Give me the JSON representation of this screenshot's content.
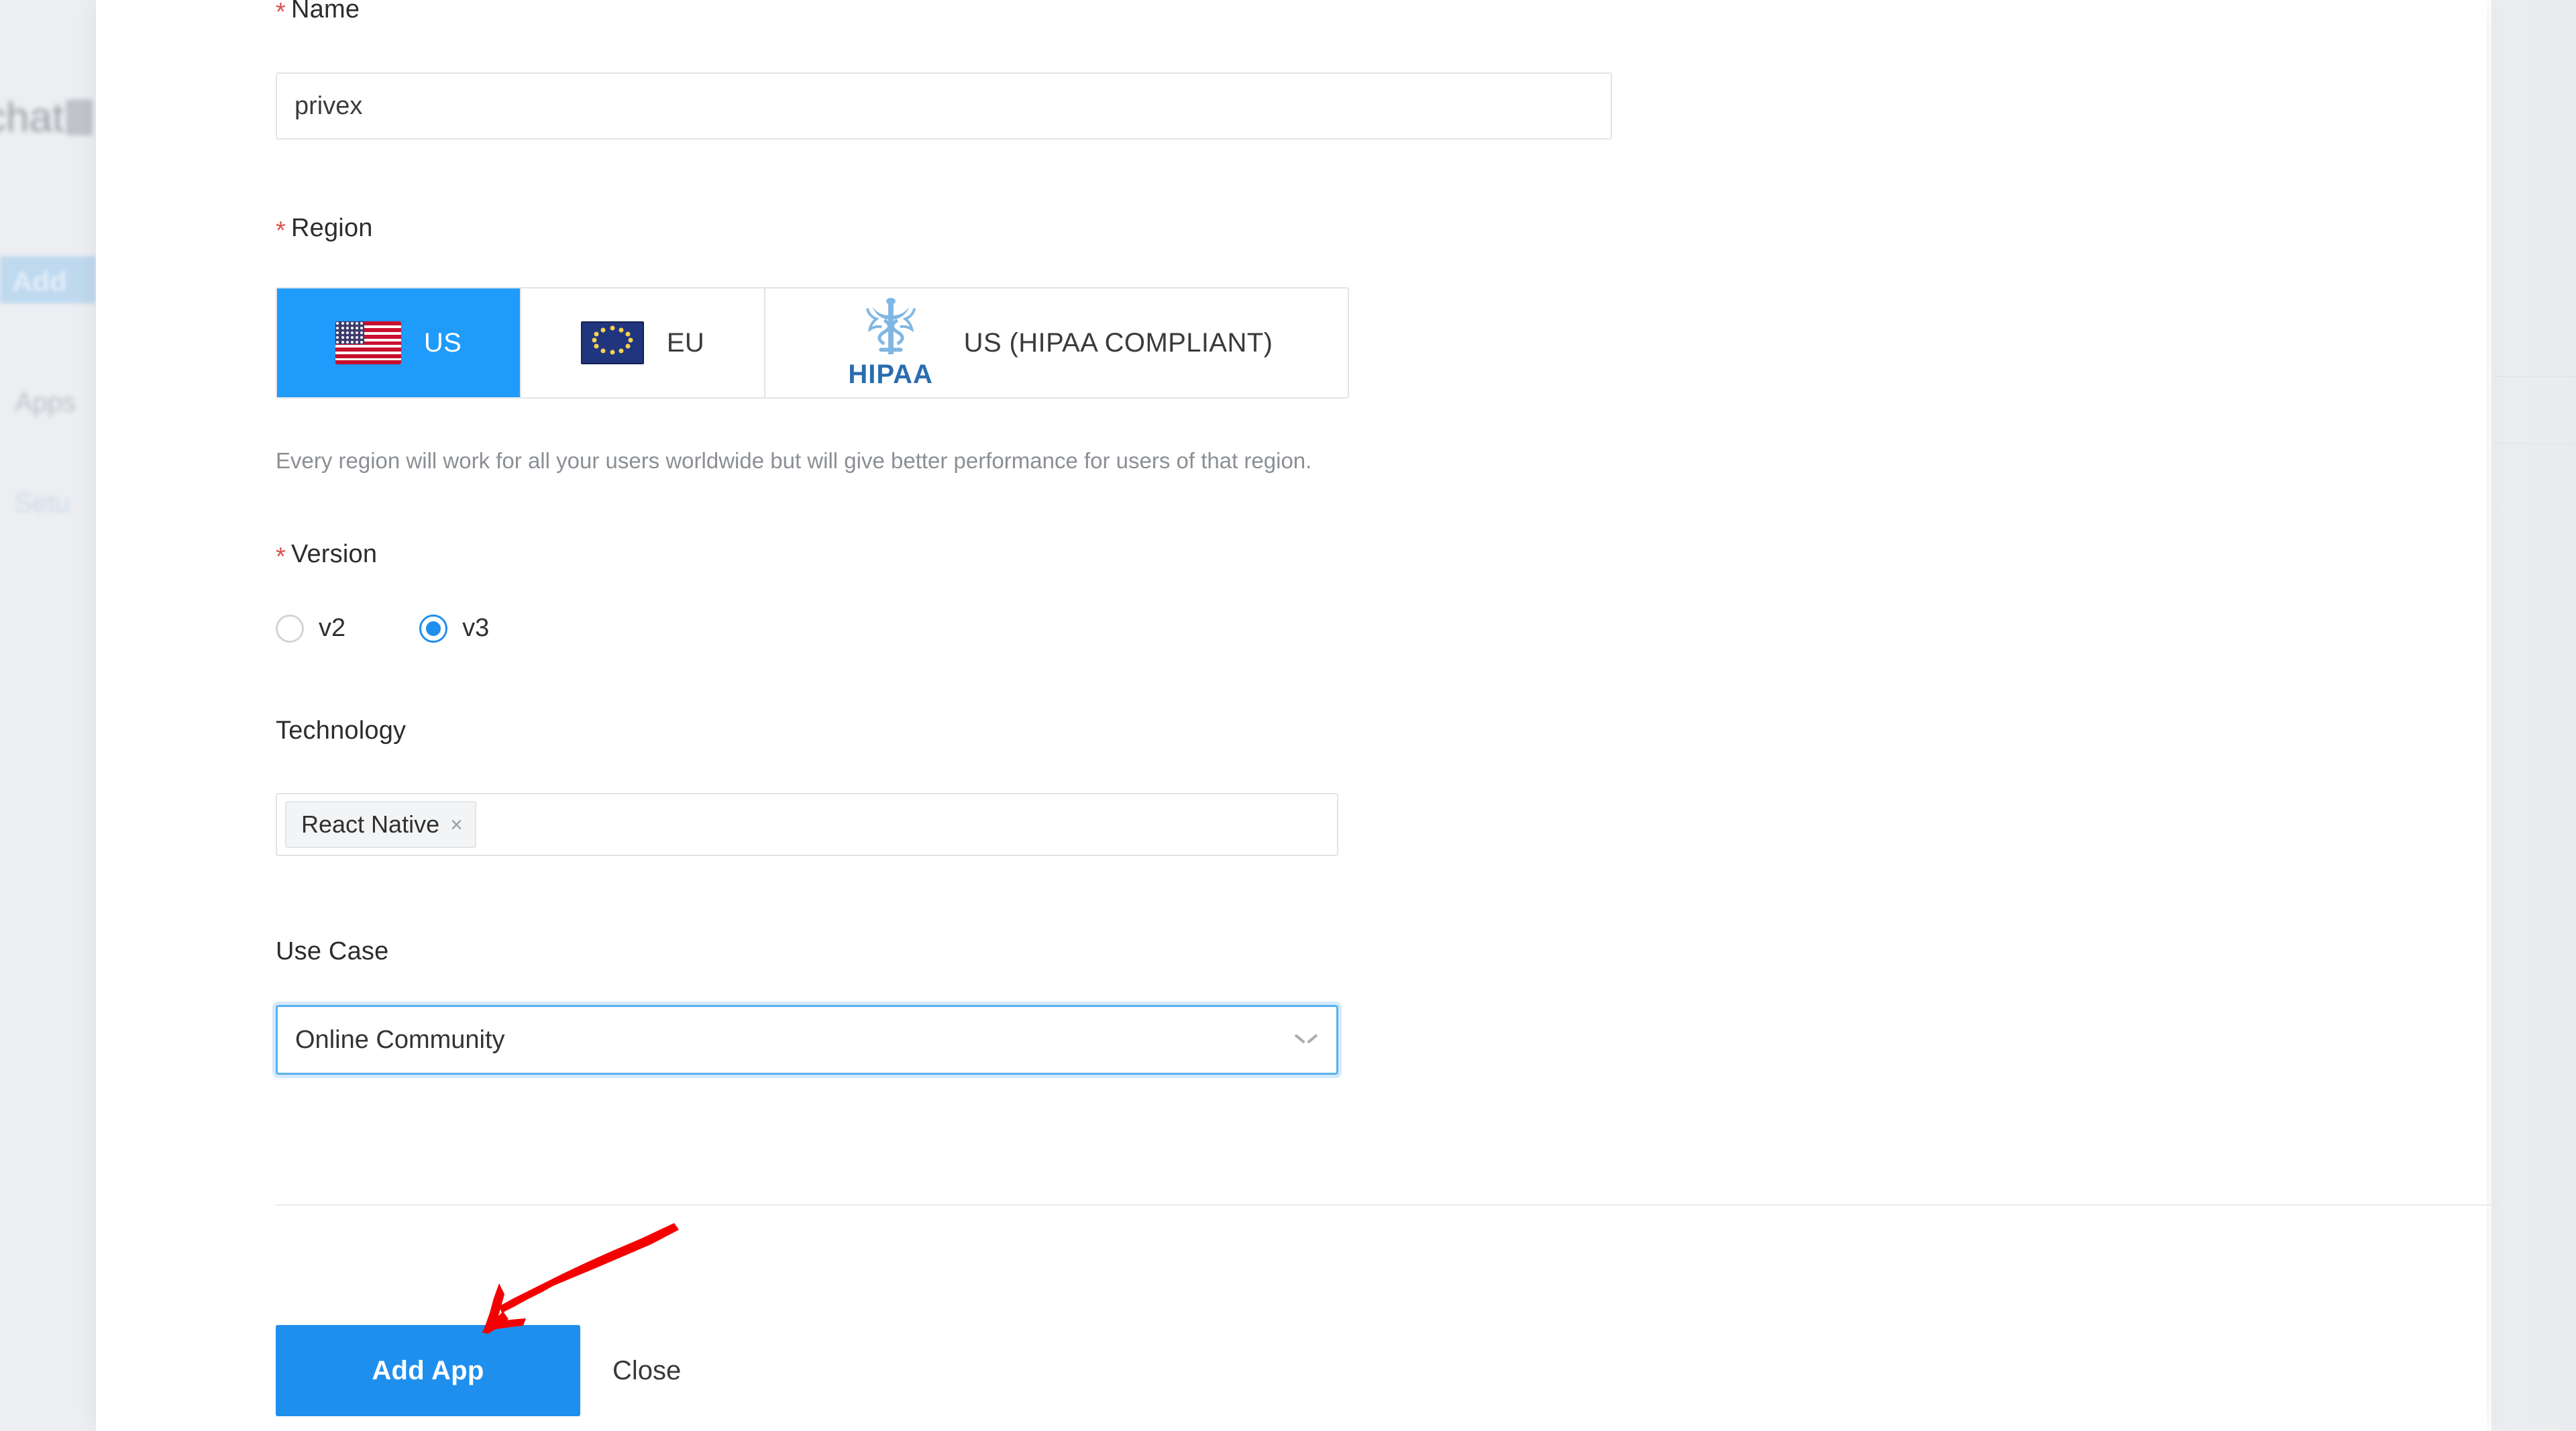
{
  "background": {
    "app_title": "chat",
    "nav_items": [
      "Add",
      "Apps",
      "Setu"
    ]
  },
  "modal": {
    "fields": {
      "name": {
        "label": "Name",
        "required_marker": "*",
        "value": "privex",
        "placeholder": ""
      },
      "region": {
        "label": "Region",
        "required_marker": "*",
        "options": [
          {
            "id": "us",
            "label": "US",
            "icon": "us-flag-icon",
            "selected": true
          },
          {
            "id": "eu",
            "label": "EU",
            "icon": "eu-flag-icon",
            "selected": false
          },
          {
            "id": "hipaa",
            "label": "US (HIPAA COMPLIANT)",
            "icon": "hipaa-logo-icon",
            "selected": false
          }
        ],
        "helper_text": "Every region will work for all your users worldwide but will give better performance for users of that region."
      },
      "version": {
        "label": "Version",
        "required_marker": "*",
        "options": [
          {
            "id": "v2",
            "label": "v2",
            "selected": false
          },
          {
            "id": "v3",
            "label": "v3",
            "selected": true
          }
        ]
      },
      "technology": {
        "label": "Technology",
        "tags": [
          {
            "label": "React Native",
            "remove_icon": "×"
          }
        ]
      },
      "use_case": {
        "label": "Use Case",
        "value": "Online Community",
        "chevron_icon": "chevron-down-icon"
      }
    },
    "footer": {
      "primary_label": "Add App",
      "close_label": "Close"
    }
  },
  "annotation": {
    "arrow_color": "#f40000",
    "points_to": "add-app-button"
  },
  "colors": {
    "accent": "#1f8fee",
    "region_selected": "#1f9bfb",
    "required_star": "#d9534f",
    "border": "#e2e4e7",
    "focus_border": "#5ab0ee",
    "hipaa_blue": "#2a6db0",
    "annotation_red": "#f40000"
  }
}
